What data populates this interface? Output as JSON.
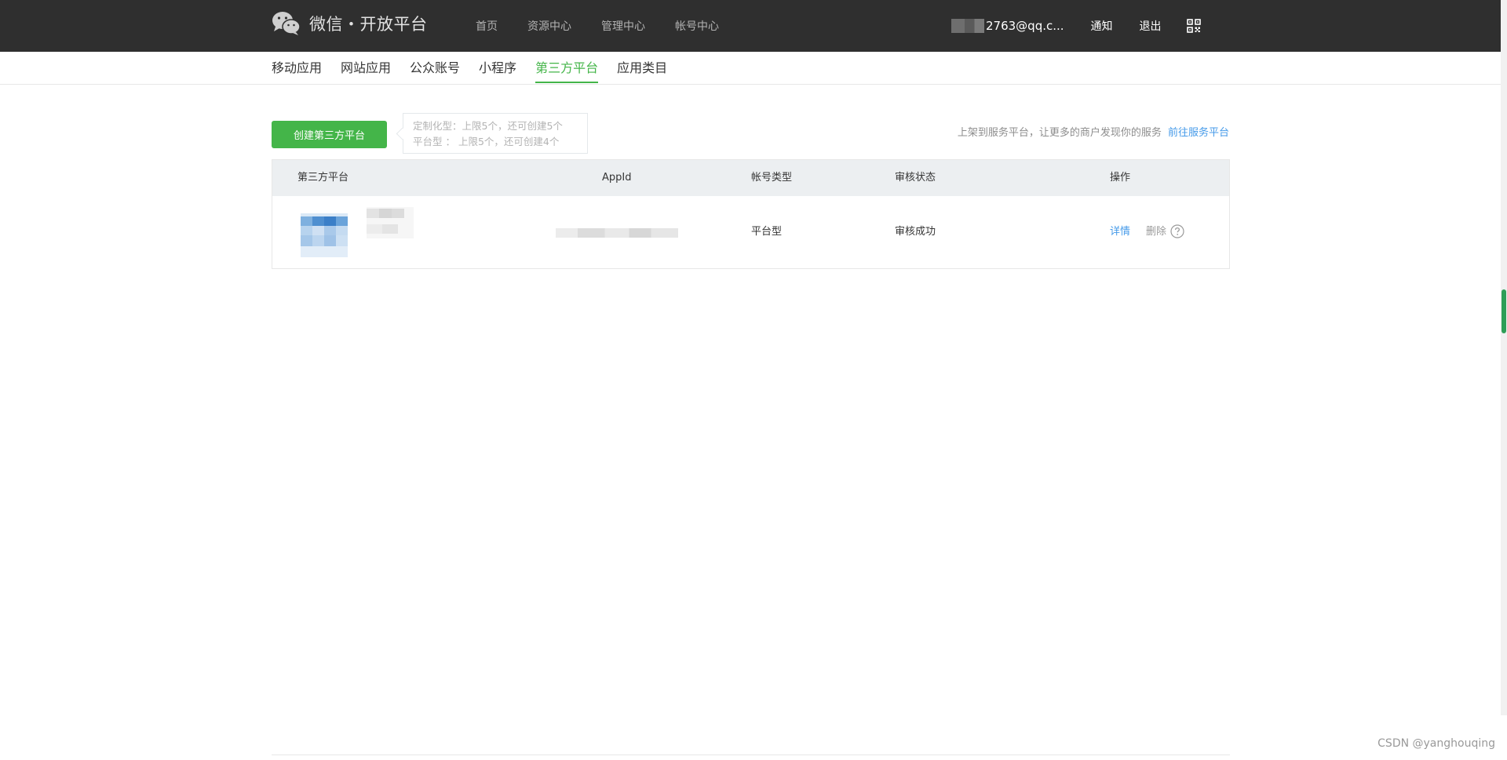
{
  "header": {
    "title": "微信・开放平台",
    "nav": [
      "首页",
      "资源中心",
      "管理中心",
      "帐号中心"
    ],
    "account_email": "2763@qq.c...",
    "notify_label": "通知",
    "logout_label": "退出"
  },
  "subnav": {
    "items": [
      "移动应用",
      "网站应用",
      "公众账号",
      "小程序",
      "第三方平台",
      "应用类目"
    ],
    "active": "第三方平台"
  },
  "actions": {
    "create_button": "创建第三方平台",
    "quota_custom": "定制化型：上限5个，还可创建5个",
    "quota_platform": "平台型 ： 上限5个，还可创建4个",
    "promo_text": "上架到服务平台，让更多的商户发现你的服务",
    "promo_link": "前往服务平台"
  },
  "table": {
    "columns": [
      "第三方平台",
      "AppId",
      "帐号类型",
      "审核状态",
      "操作"
    ],
    "rows": [
      {
        "account_type": "平台型",
        "status": "审核成功",
        "detail": "详情",
        "delete": "删除"
      }
    ]
  },
  "watermark": "CSDN @yanghouqing",
  "colors": {
    "accent": "#44b549",
    "link": "#459ae9",
    "topbar": "#2f2f2f",
    "table_header": "#eceff1"
  }
}
